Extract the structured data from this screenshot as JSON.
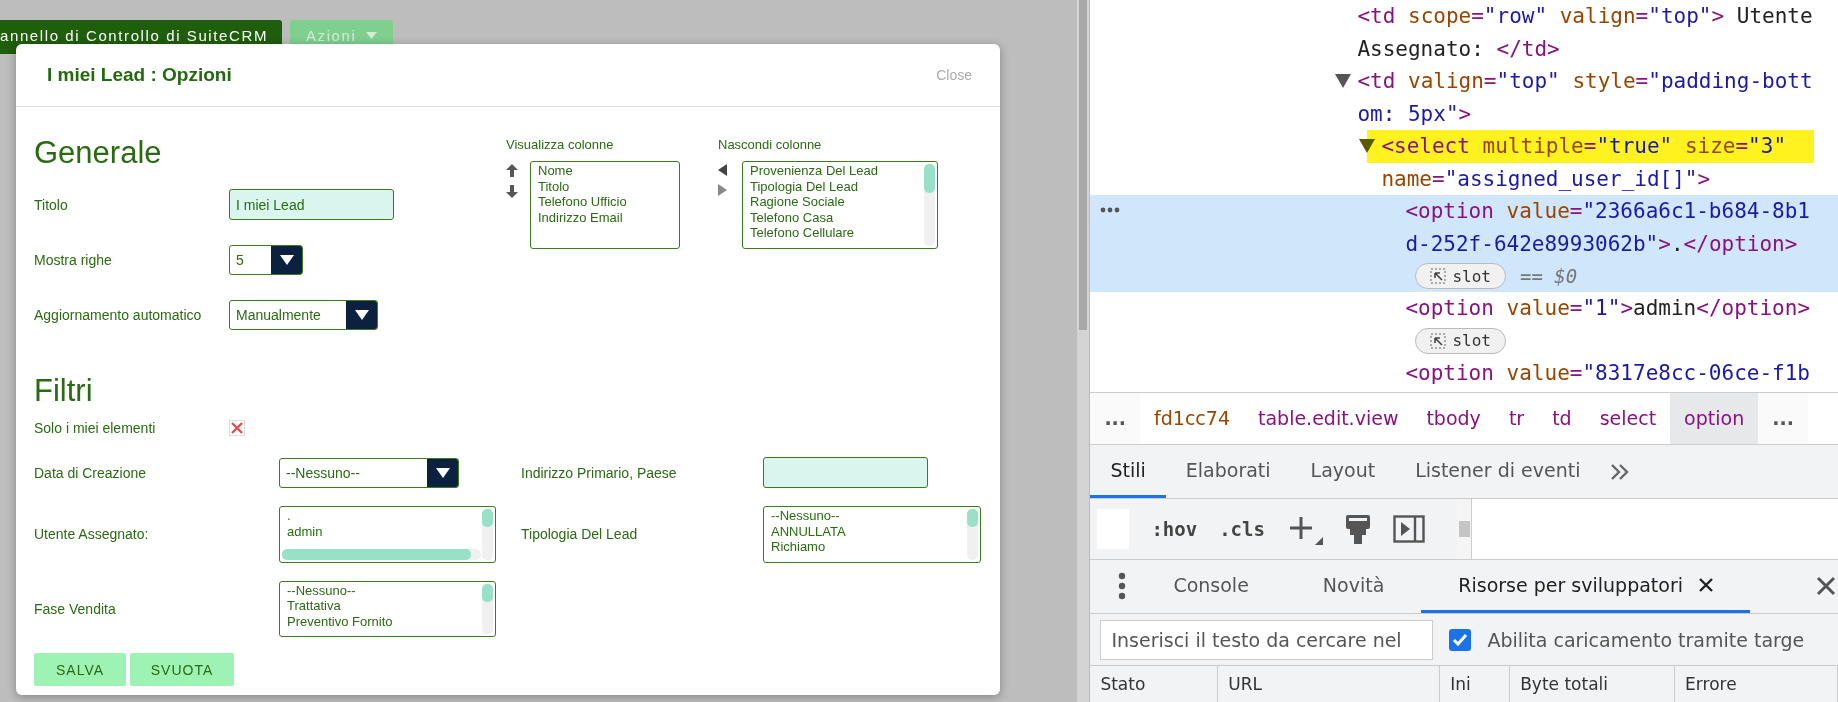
{
  "page": {
    "top_bar": {
      "title": "annello di Controllo di SuiteCRM",
      "actions_button": "Azioni"
    }
  },
  "dialog": {
    "title": "I miei Lead : Opzioni",
    "close": "Close",
    "general": {
      "heading": "Generale",
      "fields": [
        {
          "label": "Titolo",
          "kind": "text",
          "value": "I miei Lead"
        },
        {
          "label": "Mostra righe",
          "kind": "select",
          "value": "5"
        },
        {
          "label": "Aggiornamento automatico",
          "kind": "select",
          "value": "Manualmente"
        }
      ]
    },
    "columns": {
      "shown": {
        "label": "Visualizza colonne",
        "items": [
          "Nome",
          "Titolo",
          "Telefono Ufficio",
          "Indirizzo Email"
        ]
      },
      "hidden": {
        "label": "Nascondi colonne",
        "items": [
          "Provenienza Del Lead",
          "Tipologia Del Lead",
          "Ragione Sociale",
          "Telefono Casa",
          "Telefono Cellulare"
        ]
      }
    },
    "filters": {
      "heading": "Filtri",
      "only_mine": {
        "label": "Solo i miei elementi"
      },
      "fields": [
        {
          "label": "Data di Creazione",
          "kind": "select",
          "value": "--Nessuno--"
        },
        {
          "label": "Indirizzo Primario, Paese",
          "kind": "text"
        },
        {
          "label": "Utente Assegnato:",
          "kind": "listbox",
          "items": [
            ".",
            "admin"
          ]
        },
        {
          "label": "Tipologia Del Lead",
          "kind": "listbox",
          "items": [
            "--Nessuno--",
            "ANNULLATA",
            "Richiamo"
          ]
        },
        {
          "label": "Fase Vendita",
          "kind": "listbox",
          "items": [
            "--Nessuno--",
            "Trattativa",
            "Preventivo Fornito"
          ]
        }
      ]
    },
    "buttons": [
      "SALVA",
      "SVUOTA"
    ]
  },
  "devtools": {
    "dom_tree": [
      {
        "lines": [
          [
            {
              "text": "<td",
              "kind": "tag"
            },
            {
              "text": " scope",
              "kind": "attr"
            },
            {
              "text": "=",
              "kind": "tag"
            },
            {
              "text": "\"row\"",
              "kind": "value"
            },
            {
              "text": " valign",
              "kind": "attr"
            },
            {
              "text": "=",
              "kind": "tag"
            },
            {
              "text": "\"top\"",
              "kind": "value"
            },
            {
              "text": ">",
              "kind": "tag"
            },
            {
              "text": " Utente",
              "kind": "text"
            }
          ],
          [
            {
              "text": "Assegnato: ",
              "kind": "text"
            },
            {
              "text": "</td>",
              "kind": "tag"
            }
          ]
        ]
      },
      {
        "expanded": true,
        "lines": [
          [
            {
              "text": "<td",
              "kind": "tag"
            },
            {
              "text": " valign",
              "kind": "attr"
            },
            {
              "text": "=",
              "kind": "tag"
            },
            {
              "text": "\"top\"",
              "kind": "value"
            },
            {
              "text": " style",
              "kind": "attr"
            },
            {
              "text": "=",
              "kind": "tag"
            },
            {
              "text": "\"padding-bott",
              "kind": "value"
            }
          ],
          [
            {
              "text": "om: 5px\"",
              "kind": "value"
            },
            {
              "text": ">",
              "kind": "tag"
            }
          ]
        ],
        "children": [
          {
            "expanded": true,
            "highlighted": true,
            "lines": [
              [
                {
                  "text": "<select",
                  "kind": "tag"
                },
                {
                  "text": " multiple",
                  "kind": "attr"
                },
                {
                  "text": "=",
                  "kind": "tag"
                },
                {
                  "text": "\"true\"",
                  "kind": "value"
                },
                {
                  "text": " size",
                  "kind": "attr"
                },
                {
                  "text": "=",
                  "kind": "tag"
                },
                {
                  "text": "\"3\"",
                  "kind": "value"
                }
              ],
              [
                {
                  "text": "name",
                  "kind": "attr"
                },
                {
                  "text": "=",
                  "kind": "tag"
                },
                {
                  "text": "\"assigned_user_id[]\"",
                  "kind": "value"
                },
                {
                  "text": ">",
                  "kind": "tag"
                }
              ]
            ],
            "children": [
              {
                "selected": true,
                "lines": [
                  [
                    {
                      "text": "<option",
                      "kind": "tag"
                    },
                    {
                      "text": " value",
                      "kind": "attr"
                    },
                    {
                      "text": "=",
                      "kind": "tag"
                    },
                    {
                      "text": "\"2366a6c1-b684-8b1",
                      "kind": "value"
                    }
                  ],
                  [
                    {
                      "text": "d-252f-642e8993062b\"",
                      "kind": "value"
                    },
                    {
                      "text": ">",
                      "kind": "tag"
                    },
                    {
                      "text": ".",
                      "kind": "text"
                    },
                    {
                      "text": "</option>",
                      "kind": "tag"
                    }
                  ]
                ],
                "badge": "slot",
                "reference": "== $0"
              },
              {
                "selected": false,
                "lines": [
                  [
                    {
                      "text": "<option",
                      "kind": "tag"
                    },
                    {
                      "text": " value",
                      "kind": "attr"
                    },
                    {
                      "text": "=",
                      "kind": "tag"
                    },
                    {
                      "text": "\"1\"",
                      "kind": "value"
                    },
                    {
                      "text": ">",
                      "kind": "tag"
                    },
                    {
                      "text": "admin",
                      "kind": "text"
                    },
                    {
                      "text": "</option>",
                      "kind": "tag"
                    }
                  ]
                ],
                "badge": "slot"
              },
              {
                "selected": false,
                "lines": [
                  [
                    {
                      "text": "<option",
                      "kind": "tag"
                    },
                    {
                      "text": " value",
                      "kind": "attr"
                    },
                    {
                      "text": "=",
                      "kind": "tag"
                    },
                    {
                      "text": "\"8317e8cc-06ce-f1b",
                      "kind": "value"
                    }
                  ]
                ]
              }
            ]
          }
        ]
      }
    ],
    "breadcrumb": [
      {
        "label": "...",
        "kind": "more",
        "selected": false
      },
      {
        "label": "fd1cc74",
        "kind": "id",
        "selected": false
      },
      {
        "label": "table.edit.view",
        "kind": "tag",
        "selected": false
      },
      {
        "label": "tbody",
        "kind": "tag",
        "selected": false
      },
      {
        "label": "tr",
        "kind": "tag",
        "selected": false
      },
      {
        "label": "td",
        "kind": "tag",
        "selected": false
      },
      {
        "label": "select",
        "kind": "tag",
        "selected": false
      },
      {
        "label": "option",
        "kind": "tag",
        "selected": true
      },
      {
        "label": "...",
        "kind": "more",
        "selected": false
      }
    ],
    "tabs": [
      {
        "label": "Stili",
        "selected": true
      },
      {
        "label": "Elaborati",
        "selected": false
      },
      {
        "label": "Layout",
        "selected": false
      },
      {
        "label": "Listener di eventi",
        "selected": false
      }
    ],
    "style_tools": [
      ":hov",
      ".cls"
    ],
    "drawer_tabs": [
      {
        "label": "Console",
        "selected": false,
        "closable": false
      },
      {
        "label": "Novità",
        "selected": false,
        "closable": false
      },
      {
        "label": "Risorse per sviluppatori",
        "selected": true,
        "closable": true
      }
    ],
    "search": {
      "placeholder": "Inserisci il testo da cercare nel"
    },
    "option": {
      "label": "Abilita caricamento tramite targe",
      "checked": true
    },
    "table": {
      "columns": [
        "Stato",
        "URL",
        "Ini",
        "Byte totali",
        "Errore"
      ]
    }
  }
}
